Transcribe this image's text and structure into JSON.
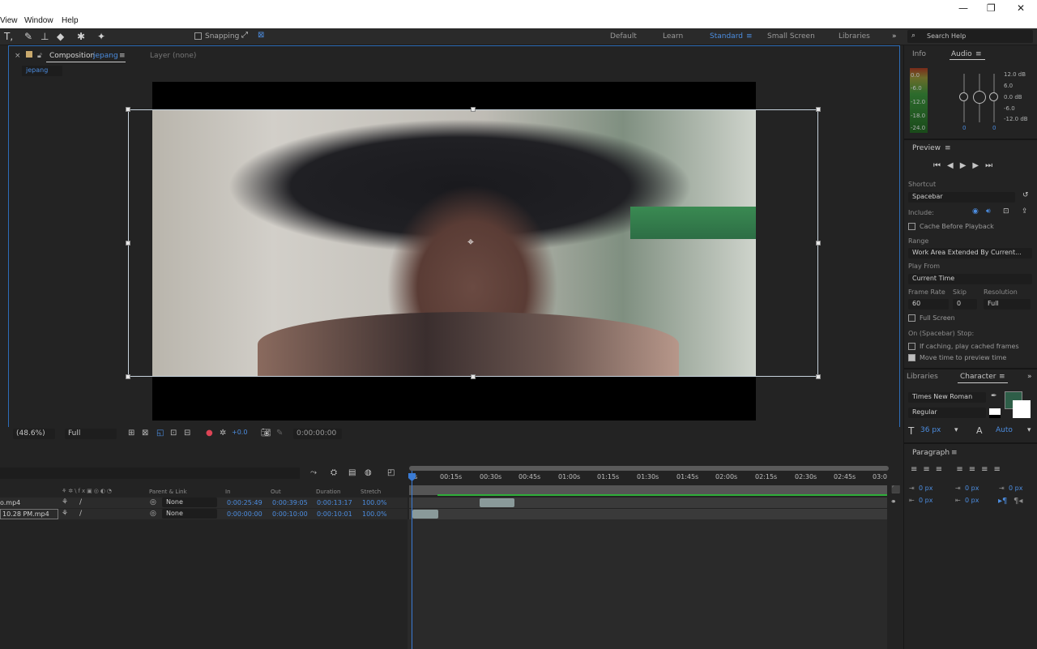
{
  "menubar": {
    "items": [
      "View",
      "Window",
      "Help"
    ]
  },
  "toolbar": {
    "snapping_label": "Snapping"
  },
  "workspaces": {
    "items": [
      "Default",
      "Learn",
      "Standard",
      "Small Screen",
      "Libraries"
    ],
    "active": "Standard"
  },
  "search": {
    "placeholder": "Search Help"
  },
  "composition": {
    "tab_prefix": "Composition",
    "comp_name": "jepang",
    "layer_tab": "Layer (none)",
    "breadcrumb": "jepang"
  },
  "viewer_controls": {
    "zoom": "(48.6%)",
    "resolution": "Full",
    "exposure": "+0.0",
    "timecode": "0:00:00:00"
  },
  "info_panel": {
    "info_tab": "Info",
    "audio_tab": "Audio",
    "meter_left_labels": [
      "0.0",
      "-6.0",
      "-12.0",
      "-18.0",
      "-24.0"
    ],
    "meter_right_labels": [
      "12.0 dB",
      "6.0",
      "0.0 dB",
      "-6.0",
      "-12.0 dB"
    ],
    "val_left": "0",
    "val_right": "0"
  },
  "preview": {
    "title": "Preview",
    "shortcut_label": "Shortcut",
    "shortcut_value": "Spacebar",
    "include_label": "Include:",
    "cache_before": "Cache Before Playback",
    "range_label": "Range",
    "range_value": "Work Area Extended By Current...",
    "play_from_label": "Play From",
    "play_from_value": "Current Time",
    "frame_rate_label": "Frame Rate",
    "skip_label": "Skip",
    "resolution_label": "Resolution",
    "frame_rate_value": "60",
    "skip_value": "0",
    "resolution_value": "Full",
    "full_screen": "Full Screen",
    "stop_label": "On (Spacebar) Stop:",
    "if_caching": "If caching, play cached frames",
    "move_time": "Move time to preview time"
  },
  "character": {
    "libraries_tab": "Libraries",
    "character_tab": "Character",
    "font": "Times New Roman",
    "style": "Regular",
    "size": "36 px",
    "leading": "Auto",
    "fill_color": "#2e5e48"
  },
  "paragraph": {
    "title": "Paragraph",
    "indent_left": "0 px",
    "indent_first": "0 px",
    "space_before": "0 px",
    "indent_right": "0 px",
    "space_after": "0 px"
  },
  "timeline": {
    "headers": {
      "parent": "Parent & Link",
      "in": "In",
      "out": "Out",
      "duration": "Duration",
      "stretch": "Stretch"
    },
    "ruler": [
      "0s",
      "00:15s",
      "00:30s",
      "00:45s",
      "01:00s",
      "01:15s",
      "01:30s",
      "01:45s",
      "02:00s",
      "02:15s",
      "02:30s",
      "02:45s",
      "03:0"
    ],
    "layers": [
      {
        "name": "o.mp4",
        "parent": "None",
        "in": "0:00:25:49",
        "out": "0:00:39:05",
        "duration": "0:00:13:17",
        "stretch": "100.0%"
      },
      {
        "name": "10.28 PM.mp4",
        "parent": "None",
        "in": "0:00:00:00",
        "out": "0:00:10:00",
        "duration": "0:00:10:01",
        "stretch": "100.0%"
      }
    ]
  }
}
